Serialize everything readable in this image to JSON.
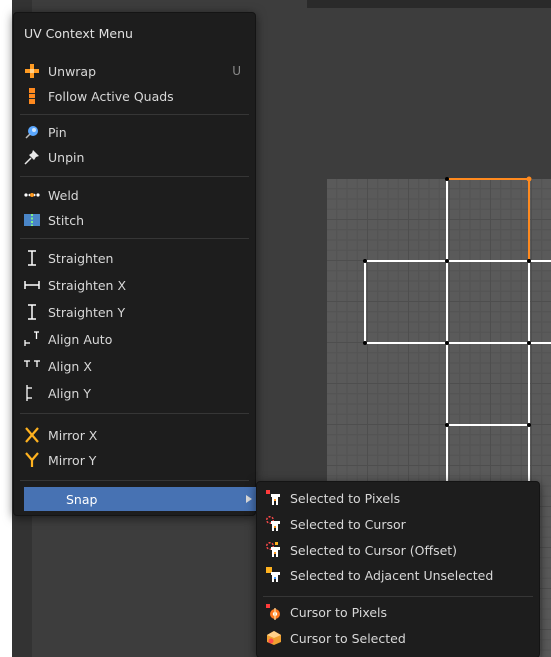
{
  "context_menu": {
    "title": "UV Context Menu",
    "items": [
      {
        "label": "Unwrap",
        "shortcut": "U",
        "icon": "unwrap-icon"
      },
      {
        "label": "Follow Active Quads",
        "icon": "follow-active-quads-icon"
      },
      {
        "label": "Pin",
        "icon": "pin-icon"
      },
      {
        "label": "Unpin",
        "icon": "unpin-icon"
      },
      {
        "label": "Weld",
        "icon": "weld-icon"
      },
      {
        "label": "Stitch",
        "icon": "stitch-icon"
      },
      {
        "label": "Straighten",
        "icon": "straighten-icon"
      },
      {
        "label": "Straighten X",
        "icon": "straighten-x-icon"
      },
      {
        "label": "Straighten Y",
        "icon": "straighten-y-icon"
      },
      {
        "label": "Align Auto",
        "icon": "align-auto-icon"
      },
      {
        "label": "Align X",
        "icon": "align-x-icon"
      },
      {
        "label": "Align Y",
        "icon": "align-y-icon"
      },
      {
        "label": "Mirror X",
        "icon": "mirror-x-icon"
      },
      {
        "label": "Mirror Y",
        "icon": "mirror-y-icon"
      },
      {
        "label": "Snap",
        "icon": "submenu-arrow-icon"
      }
    ]
  },
  "snap_menu": {
    "items": [
      {
        "label": "Selected to Pixels",
        "icon": "snap-selected-to-pixels-icon"
      },
      {
        "label": "Selected to Cursor",
        "icon": "snap-selected-to-cursor-icon"
      },
      {
        "label": "Selected to Cursor (Offset)",
        "icon": "snap-selected-to-cursor-offset-icon"
      },
      {
        "label": "Selected to Adjacent Unselected",
        "icon": "snap-selected-to-adjacent-icon"
      },
      {
        "label": "Cursor to Pixels",
        "icon": "cursor-to-pixels-icon"
      },
      {
        "label": "Cursor to Selected",
        "icon": "cursor-to-selected-icon"
      }
    ]
  },
  "colors": {
    "menu_bg": "#1d1d1d",
    "highlight": "#4772b3",
    "text": "#d8d8d8",
    "shortcut": "#8a8a8a",
    "uv_edge": "#ffffff",
    "uv_selected": "#ff8a1f",
    "grid_bg": "#5a5a5a"
  }
}
